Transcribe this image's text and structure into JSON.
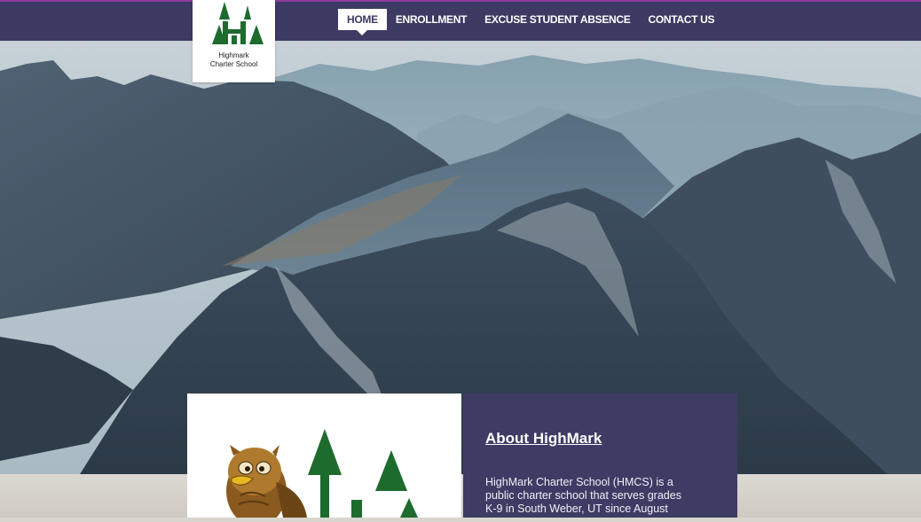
{
  "nav": {
    "items": [
      "HOME",
      "ENROLLMENT",
      "EXCUSE STUDENT ABSENCE",
      "CONTACT US"
    ],
    "active_index": 0
  },
  "logo": {
    "line1": "Highmark",
    "line2": "Charter School"
  },
  "about": {
    "title": "About HighMark",
    "body_lines": [
      "HighMark Charter School (HMCS) is a",
      "public charter school that serves grades",
      "K-9 in South Weber, UT since August"
    ]
  },
  "colors": {
    "nav_bg": "#3d3a63",
    "accent_top_border": "#8f3b9c",
    "about_bg": "#3e3b64",
    "logo_green": "#1e6b2e"
  },
  "icons": [
    "school-logo-icon",
    "owl-mascot-icon",
    "tree-logo-icon"
  ]
}
